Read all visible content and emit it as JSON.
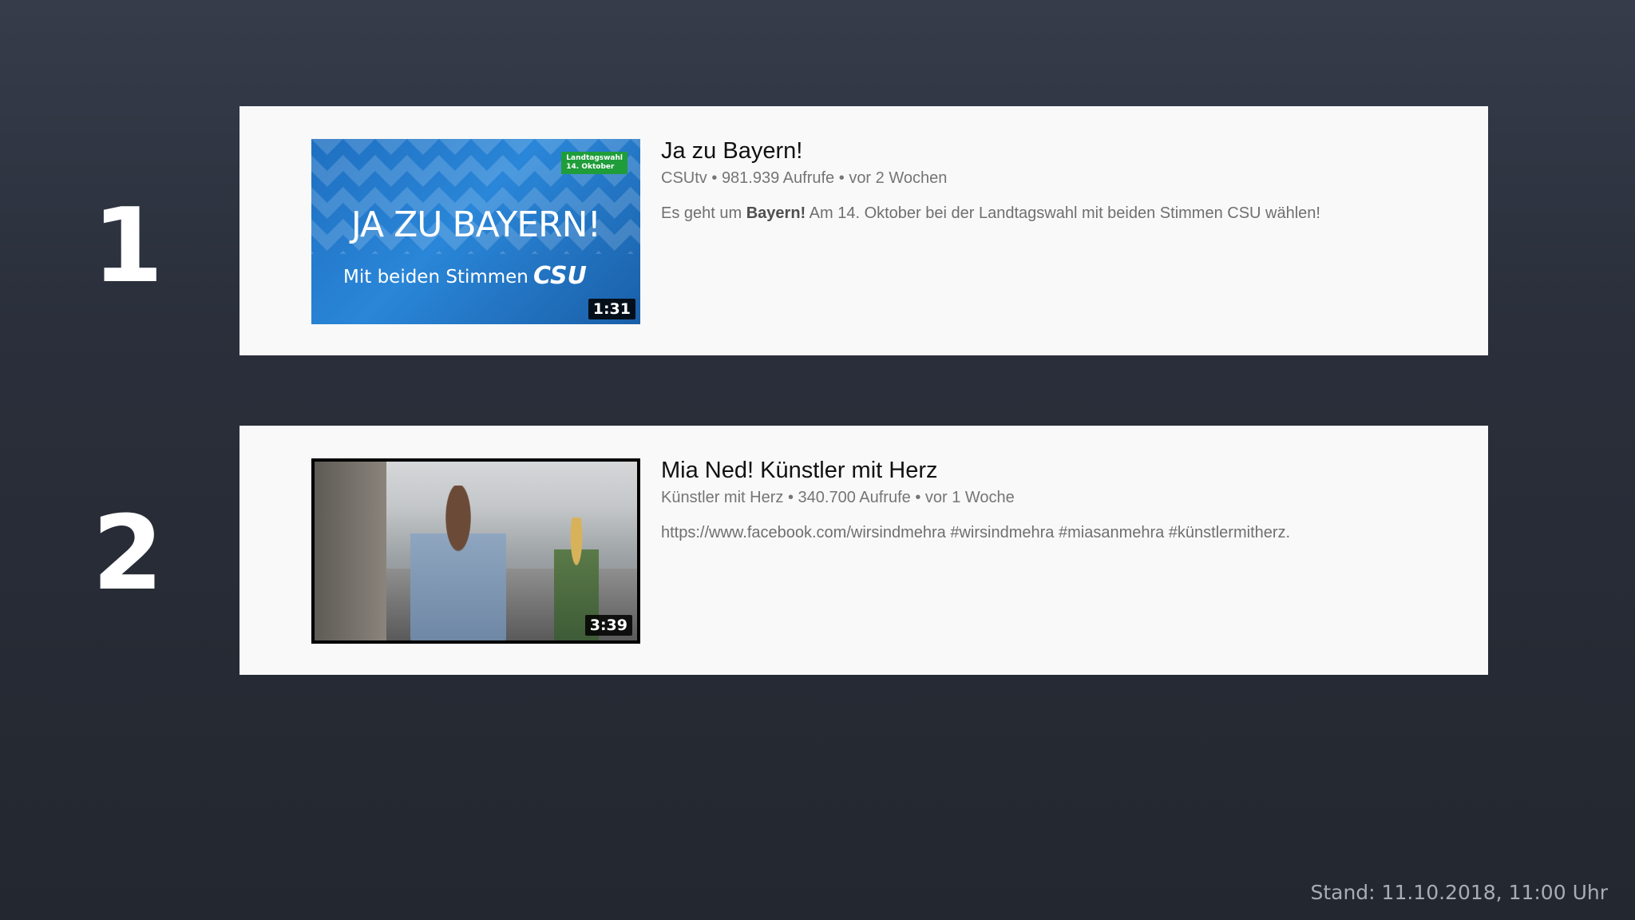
{
  "ranking": [
    {
      "rank": "1",
      "video": {
        "title": "Ja zu Bayern!",
        "channel": "CSUtv",
        "views": "981.939 Aufrufe",
        "age": "vor 2 Wochen",
        "description_prefix": "Es geht um ",
        "description_bold": "Bayern!",
        "description_suffix": " Am 14. Oktober bei der Landtagswahl mit beiden Stimmen CSU wählen!",
        "duration": "1:31",
        "thumbnail": {
          "badge_line1": "Landtagswahl",
          "badge_line2": "14. Oktober",
          "headline": "JA ZU BAYERN!",
          "subline": "Mit beiden Stimmen",
          "logo": "CSU"
        }
      }
    },
    {
      "rank": "2",
      "video": {
        "title": "Mia Ned! Künstler mit Herz",
        "channel": "Künstler mit Herz",
        "views": "340.700 Aufrufe",
        "age": "vor 1 Woche",
        "description": "https://www.facebook.com/wirsindmehra #wirsindmehra #miasanmehra #künstlermitherz.",
        "duration": "3:39"
      }
    }
  ],
  "meta_separator": "•",
  "footer": {
    "stand": "Stand: 11.10.2018, 11:00 Uhr"
  },
  "colors": {
    "background": "#2a2f3b",
    "card": "#f9f9f9",
    "csu_blue": "#2a86d8",
    "badge_green": "#1f9d3a"
  }
}
